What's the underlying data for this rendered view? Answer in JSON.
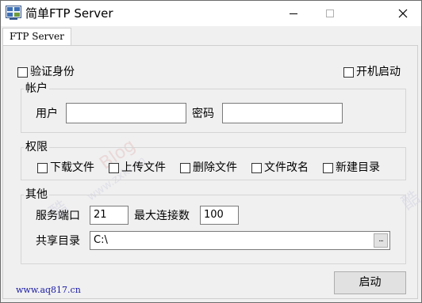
{
  "window": {
    "title": "简单FTP Server",
    "icon": "app-icon"
  },
  "tabs": [
    {
      "label": "FTP Server",
      "selected": true
    }
  ],
  "options": {
    "verify_identity": {
      "label": "验证身份",
      "checked": false
    },
    "auto_start": {
      "label": "开机启动",
      "checked": false
    }
  },
  "account": {
    "group_label": "帐户",
    "user_label": "用户",
    "user_value": "",
    "password_label": "密码",
    "password_value": ""
  },
  "permissions": {
    "group_label": "权限",
    "items": [
      {
        "label": "下载文件",
        "checked": false
      },
      {
        "label": "上传文件",
        "checked": false
      },
      {
        "label": "删除文件",
        "checked": false
      },
      {
        "label": "文件改名",
        "checked": false
      },
      {
        "label": "新建目录",
        "checked": false
      }
    ]
  },
  "other": {
    "group_label": "其他",
    "port_label": "服务端口",
    "port_value": "21",
    "max_conn_label": "最大连接数",
    "max_conn_value": "100",
    "share_dir_label": "共享目录",
    "share_dir_value": "C:\\",
    "browse_label": "..."
  },
  "footer": {
    "link": "www.aq817.cn",
    "start_button": "启动"
  },
  "watermark": {
    "text1": "酷",
    "text2": "Blog",
    "text3": "www.zxki.cn",
    "text4": "酷"
  }
}
